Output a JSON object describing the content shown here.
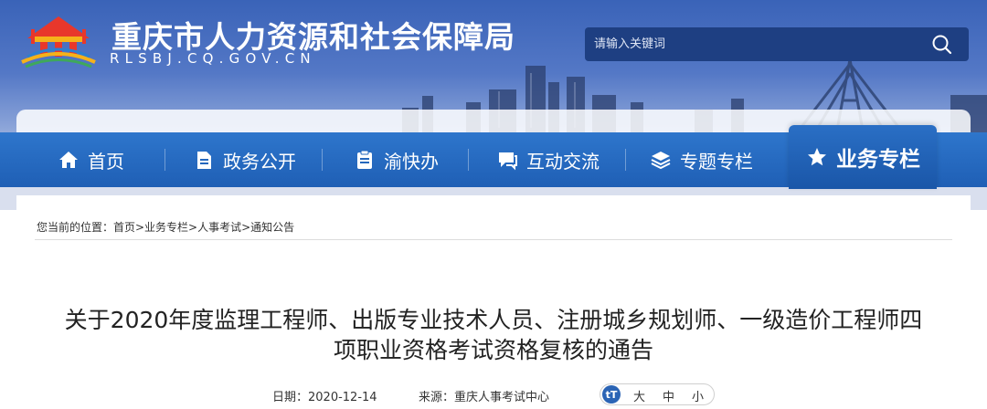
{
  "header": {
    "site_title": "重庆市人力资源和社会保障局",
    "site_domain": "RLSBJ.CQ.GOV.CN",
    "logo_icon": "city-gate-logo-icon",
    "search": {
      "placeholder": "请输入关键词",
      "icon": "search-icon"
    }
  },
  "nav": {
    "items": [
      {
        "label": "首页",
        "icon": "home-icon"
      },
      {
        "label": "政务公开",
        "icon": "document-icon"
      },
      {
        "label": "渝快办",
        "icon": "clipboard-icon"
      },
      {
        "label": "互动交流",
        "icon": "chat-icon"
      },
      {
        "label": "专题专栏",
        "icon": "layers-icon"
      },
      {
        "label": "业务专栏",
        "icon": "star-icon",
        "active": true
      }
    ],
    "active_color": "#1a56a8",
    "bar_color": "#2e76cc"
  },
  "breadcrumb": {
    "text": "您当前的位置：首页>业务专栏>人事考试>通知公告"
  },
  "article": {
    "title_line1": "关于2020年度监理工程师、出版专业技术人员、注册城乡规划师、一级造价工程师四",
    "title_line2": "项职业资格考试资格复核的通告",
    "date_label": "日期：2020-12-14",
    "source_label": "来源：重庆人事考试中心",
    "font_size_options": [
      "大",
      "中",
      "小"
    ],
    "font_size_icon": "text-size-icon"
  }
}
